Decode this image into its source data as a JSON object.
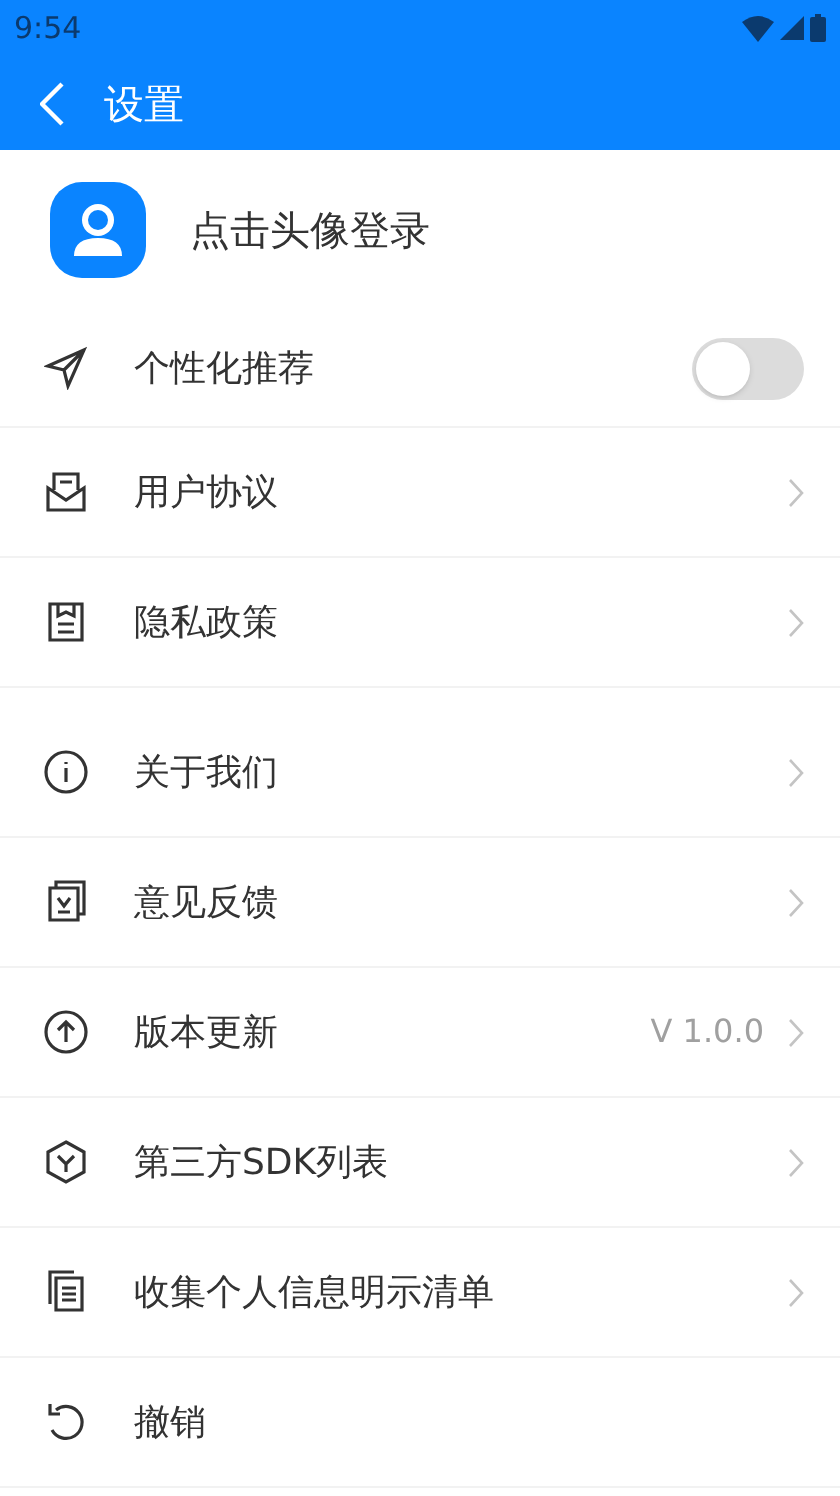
{
  "status_bar": {
    "time": "9:54"
  },
  "app_bar": {
    "title": "设置"
  },
  "profile": {
    "label": "点击头像登录"
  },
  "sections": [
    [
      {
        "kind": "toggle",
        "label": "个性化推荐",
        "on": false
      },
      {
        "kind": "link",
        "label": "用户协议"
      },
      {
        "kind": "link",
        "label": "隐私政策"
      }
    ],
    [
      {
        "kind": "link",
        "label": "关于我们"
      },
      {
        "kind": "link",
        "label": "意见反馈"
      },
      {
        "kind": "link",
        "label": "版本更新",
        "value": "V 1.0.0"
      },
      {
        "kind": "link",
        "label": "第三方SDK列表"
      },
      {
        "kind": "link",
        "label": "收集个人信息明示清单"
      },
      {
        "kind": "action",
        "label": "撤销"
      }
    ]
  ]
}
